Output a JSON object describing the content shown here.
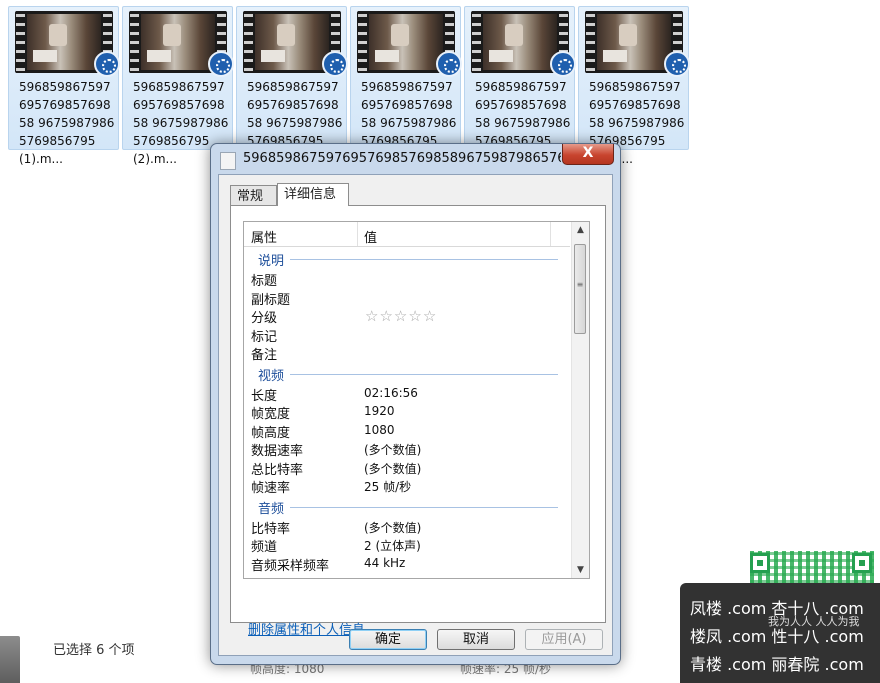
{
  "explorer": {
    "thumbnails": [
      {
        "label": "59685986759769576985769858 96759879865769856795 (1).m..."
      },
      {
        "label": "59685986759769576985769858 96759879865769856795 (2).m..."
      },
      {
        "label": "59685986759769576985769858 96759879865769856795 (3).m..."
      },
      {
        "label": "59685986759769576985769858 96759879865769856795 (4).m..."
      },
      {
        "label": "59685986759769576985769858 96759879865769856795 (5).m..."
      },
      {
        "label": "59685986759769576985769858 96759879865769856795 (6).m..."
      }
    ],
    "status_selected": "已选择 6 个项",
    "ghost_left": "帧高度: 1080",
    "ghost_right": "帧速率: 25 帧/秒"
  },
  "dialog": {
    "title": "59685986759769576985769858967598798657698...",
    "close_label": "X",
    "tabs": [
      {
        "label": "常规"
      },
      {
        "label": "详细信息"
      }
    ],
    "columns": {
      "property": "属性",
      "value": "值"
    },
    "groups": [
      {
        "name": "说明",
        "rows": [
          {
            "key": "标题",
            "value": ""
          },
          {
            "key": "副标题",
            "value": ""
          },
          {
            "key": "分级",
            "value": "",
            "stars": 0,
            "stars_max": 5
          },
          {
            "key": "标记",
            "value": ""
          },
          {
            "key": "备注",
            "value": ""
          }
        ]
      },
      {
        "name": "视频",
        "rows": [
          {
            "key": "长度",
            "value": "02:16:56"
          },
          {
            "key": "帧宽度",
            "value": "1920"
          },
          {
            "key": "帧高度",
            "value": "1080"
          },
          {
            "key": "数据速率",
            "value": "(多个数值)"
          },
          {
            "key": "总比特率",
            "value": "(多个数值)"
          },
          {
            "key": "帧速率",
            "value": "25 帧/秒"
          }
        ]
      },
      {
        "name": "音频",
        "rows": [
          {
            "key": "比特率",
            "value": "(多个数值)"
          },
          {
            "key": "频道",
            "value": "2 (立体声)"
          },
          {
            "key": "音频采样频率",
            "value": "44 kHz"
          }
        ]
      }
    ],
    "remove_link": "删除属性和个人信息",
    "buttons": {
      "ok": "确定",
      "cancel": "取消",
      "apply": "应用(A)"
    }
  },
  "watermark": {
    "lines": [
      "凤楼 .com  杏十八 .com",
      "楼凤 .com  性十八 .com",
      "青楼 .com  丽春院 .com"
    ],
    "tag": "我为人人 人人为我"
  },
  "colors": {
    "accent_blue": "#1d4e9a",
    "close_red": "#c8452f",
    "link_blue": "#0b5fb8"
  }
}
